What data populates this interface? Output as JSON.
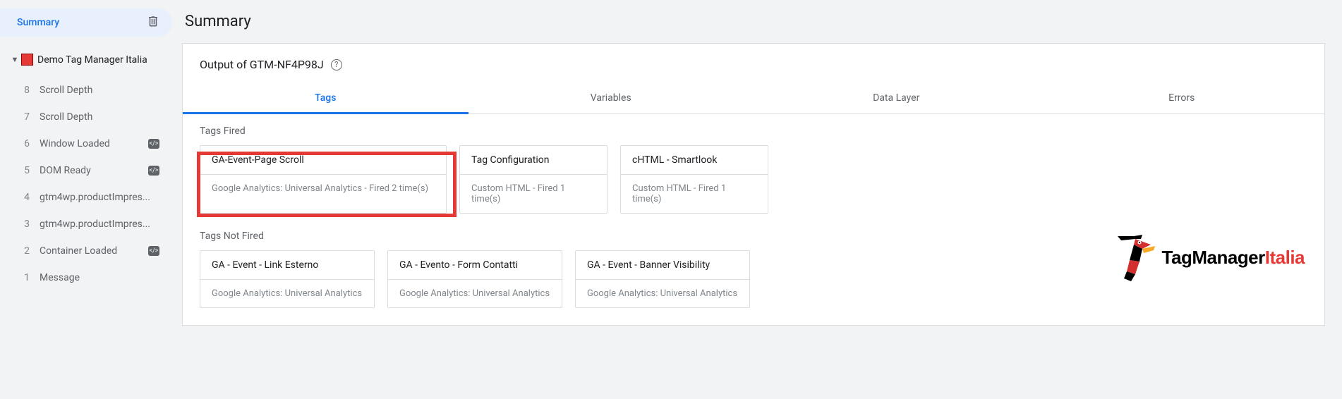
{
  "sidebar": {
    "summary_label": "Summary",
    "container": {
      "label": "Demo Tag Manager Italia"
    },
    "events": [
      {
        "num": "8",
        "label": "Scroll Depth",
        "badge": false
      },
      {
        "num": "7",
        "label": "Scroll Depth",
        "badge": false
      },
      {
        "num": "6",
        "label": "Window Loaded",
        "badge": true
      },
      {
        "num": "5",
        "label": "DOM Ready",
        "badge": true
      },
      {
        "num": "4",
        "label": "gtm4wp.productImpres...",
        "badge": false
      },
      {
        "num": "3",
        "label": "gtm4wp.productImpres...",
        "badge": false
      },
      {
        "num": "2",
        "label": "Container Loaded",
        "badge": true
      },
      {
        "num": "1",
        "label": "Message",
        "badge": false
      }
    ]
  },
  "main": {
    "title": "Summary",
    "output_label": "Output of GTM-NF4P98J",
    "tabs": [
      {
        "label": "Tags",
        "active": true
      },
      {
        "label": "Variables",
        "active": false
      },
      {
        "label": "Data Layer",
        "active": false
      },
      {
        "label": "Errors",
        "active": false
      }
    ],
    "fired_label": "Tags Fired",
    "fired": [
      {
        "title": "GA-Event-Page Scroll",
        "sub": "Google Analytics: Universal Analytics - Fired 2 time(s)",
        "highlight": true
      },
      {
        "title": "Tag Configuration",
        "sub": "Custom HTML - Fired 1 time(s)"
      },
      {
        "title": "cHTML - Smartlook",
        "sub": "Custom HTML - Fired 1 time(s)"
      }
    ],
    "not_fired_label": "Tags Not Fired",
    "not_fired": [
      {
        "title": "GA - Event - Link Esterno",
        "sub": "Google Analytics: Universal Analytics"
      },
      {
        "title": "GA - Evento - Form Contatti",
        "sub": "Google Analytics: Universal Analytics"
      },
      {
        "title": "GA - Event - Banner Visibility",
        "sub": "Google Analytics: Universal Analytics"
      }
    ]
  },
  "logo": {
    "main": "TagManager",
    "accent": "Italia"
  }
}
